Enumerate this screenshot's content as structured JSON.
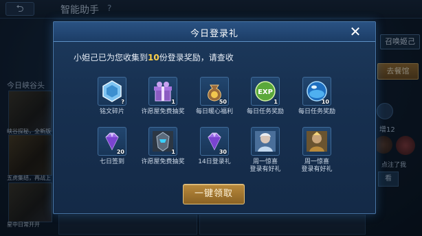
{
  "header": {
    "back_icon": "back-arrow-icon",
    "title": "智能助手",
    "help": "?"
  },
  "background": {
    "left_section_label": "今日峡谷头",
    "thumb_captions": [
      "峡谷探秘，全新版",
      "五虎集结，再战上",
      "星中日常开开"
    ],
    "friend_button": "召唤姬己",
    "remove_button": "去餐馆",
    "count_text": "增12",
    "note_text": "点注了我",
    "look_button": "看"
  },
  "modal": {
    "title": "今日登录礼",
    "close_label": "✕",
    "intro_prefix": "小妲己已为您收集到",
    "intro_count": "10",
    "intro_suffix": "份登录奖励，请查收",
    "rewards": [
      {
        "icon": "inscription-fragment-icon",
        "count": "?",
        "label": "铭文碎片"
      },
      {
        "icon": "gift-box-icon",
        "count": "1",
        "label": "许愿屋免费抽奖"
      },
      {
        "icon": "money-bag-icon",
        "count": "50",
        "label": "每日暖心福利"
      },
      {
        "icon": "exp-card-icon",
        "count": "1",
        "label": "每日任务奖励"
      },
      {
        "icon": "blue-orb-icon",
        "count": "10",
        "label": "每日任务奖励"
      },
      {
        "icon": "purple-diamond-icon",
        "count": "20",
        "label": "七日签到"
      },
      {
        "icon": "hero-skin-icon",
        "count": "1",
        "label": "许愿屋免费抽奖"
      },
      {
        "icon": "purple-diamond-icon",
        "count": "30",
        "label": "14日登录礼"
      },
      {
        "icon": "hero-portrait-icon",
        "count": "",
        "label": "周一惊喜\n登录有好礼"
      },
      {
        "icon": "hero-portrait-icon",
        "count": "",
        "label": "周一惊喜\n登录有好礼"
      }
    ],
    "claim_button": "一键领取"
  }
}
